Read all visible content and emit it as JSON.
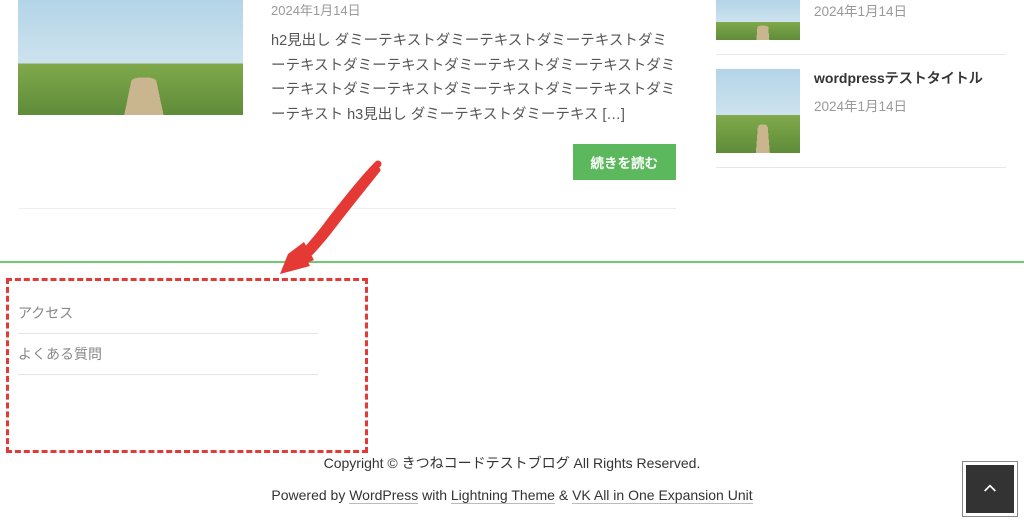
{
  "article": {
    "date": "2024年1月14日",
    "excerpt": "h2見出し ダミーテキストダミーテキストダミーテキストダミーテキストダミーテキストダミーテキストダミーテキストダミーテキストダミーテキストダミーテキストダミーテキストダミーテキスト h3見出し ダミーテキストダミーテキス […]",
    "read_more": "続きを読む"
  },
  "sidebar_items": [
    {
      "title": "",
      "date": "2024年1月14日"
    },
    {
      "title": "wordpressテストタイトル",
      "date": "2024年1月14日"
    }
  ],
  "footer_menu": {
    "items": [
      "アクセス",
      "よくある質問"
    ]
  },
  "copyright": "Copyright © きつねコードテストブログ All Rights Reserved.",
  "powered": {
    "prefix": "Powered by ",
    "wordpress": "WordPress",
    "with": " with ",
    "theme": "Lightning Theme",
    "amp": " & ",
    "unit": "VK All in One Expansion Unit"
  }
}
